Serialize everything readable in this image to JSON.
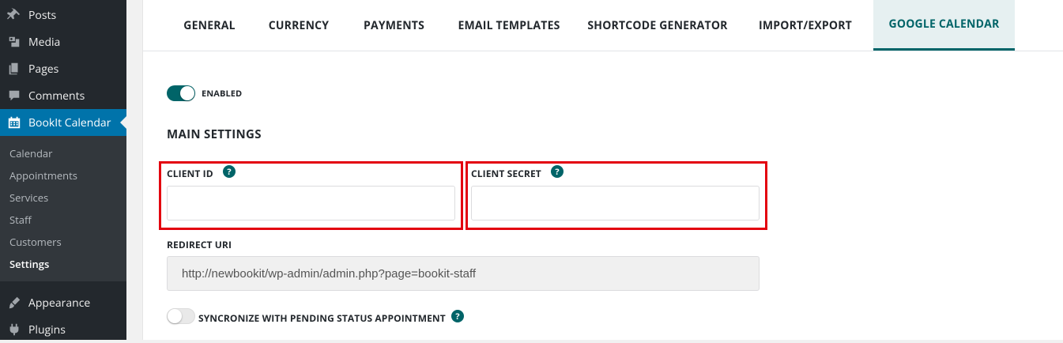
{
  "sidebar": {
    "items": [
      {
        "label": "Posts",
        "icon": "pin-icon"
      },
      {
        "label": "Media",
        "icon": "media-icon"
      },
      {
        "label": "Pages",
        "icon": "pages-icon"
      },
      {
        "label": "Comments",
        "icon": "comment-icon"
      },
      {
        "label": "BookIt Calendar",
        "icon": "calendar-icon"
      },
      {
        "label": "Appearance",
        "icon": "brush-icon"
      },
      {
        "label": "Plugins",
        "icon": "plugin-icon"
      }
    ],
    "submenu": [
      "Calendar",
      "Appointments",
      "Services",
      "Staff",
      "Customers",
      "Settings"
    ]
  },
  "tabs": [
    "GENERAL",
    "CURRENCY",
    "PAYMENTS",
    "EMAIL TEMPLATES",
    "SHORTCODE GENERATOR",
    "IMPORT/EXPORT",
    "GOOGLE CALENDAR"
  ],
  "settings": {
    "enabled_label": "ENABLED",
    "enabled": true,
    "section_title": "MAIN SETTINGS",
    "client_id_label": "CLIENT ID",
    "client_id_value": "",
    "client_secret_label": "CLIENT SECRET",
    "client_secret_value": "",
    "redirect_label": "REDIRECT URI",
    "redirect_value": "http://newbookit/wp-admin/admin.php?page=bookit-staff",
    "sync_label": "SYNCRONIZE WITH PENDING STATUS APPOINTMENT",
    "sync_enabled": false,
    "help_glyph": "?"
  },
  "colors": {
    "accent": "#006468",
    "wp_admin_blue": "#0073aa",
    "sidebar_bg": "#23282d",
    "highlight": "#e3000f"
  }
}
